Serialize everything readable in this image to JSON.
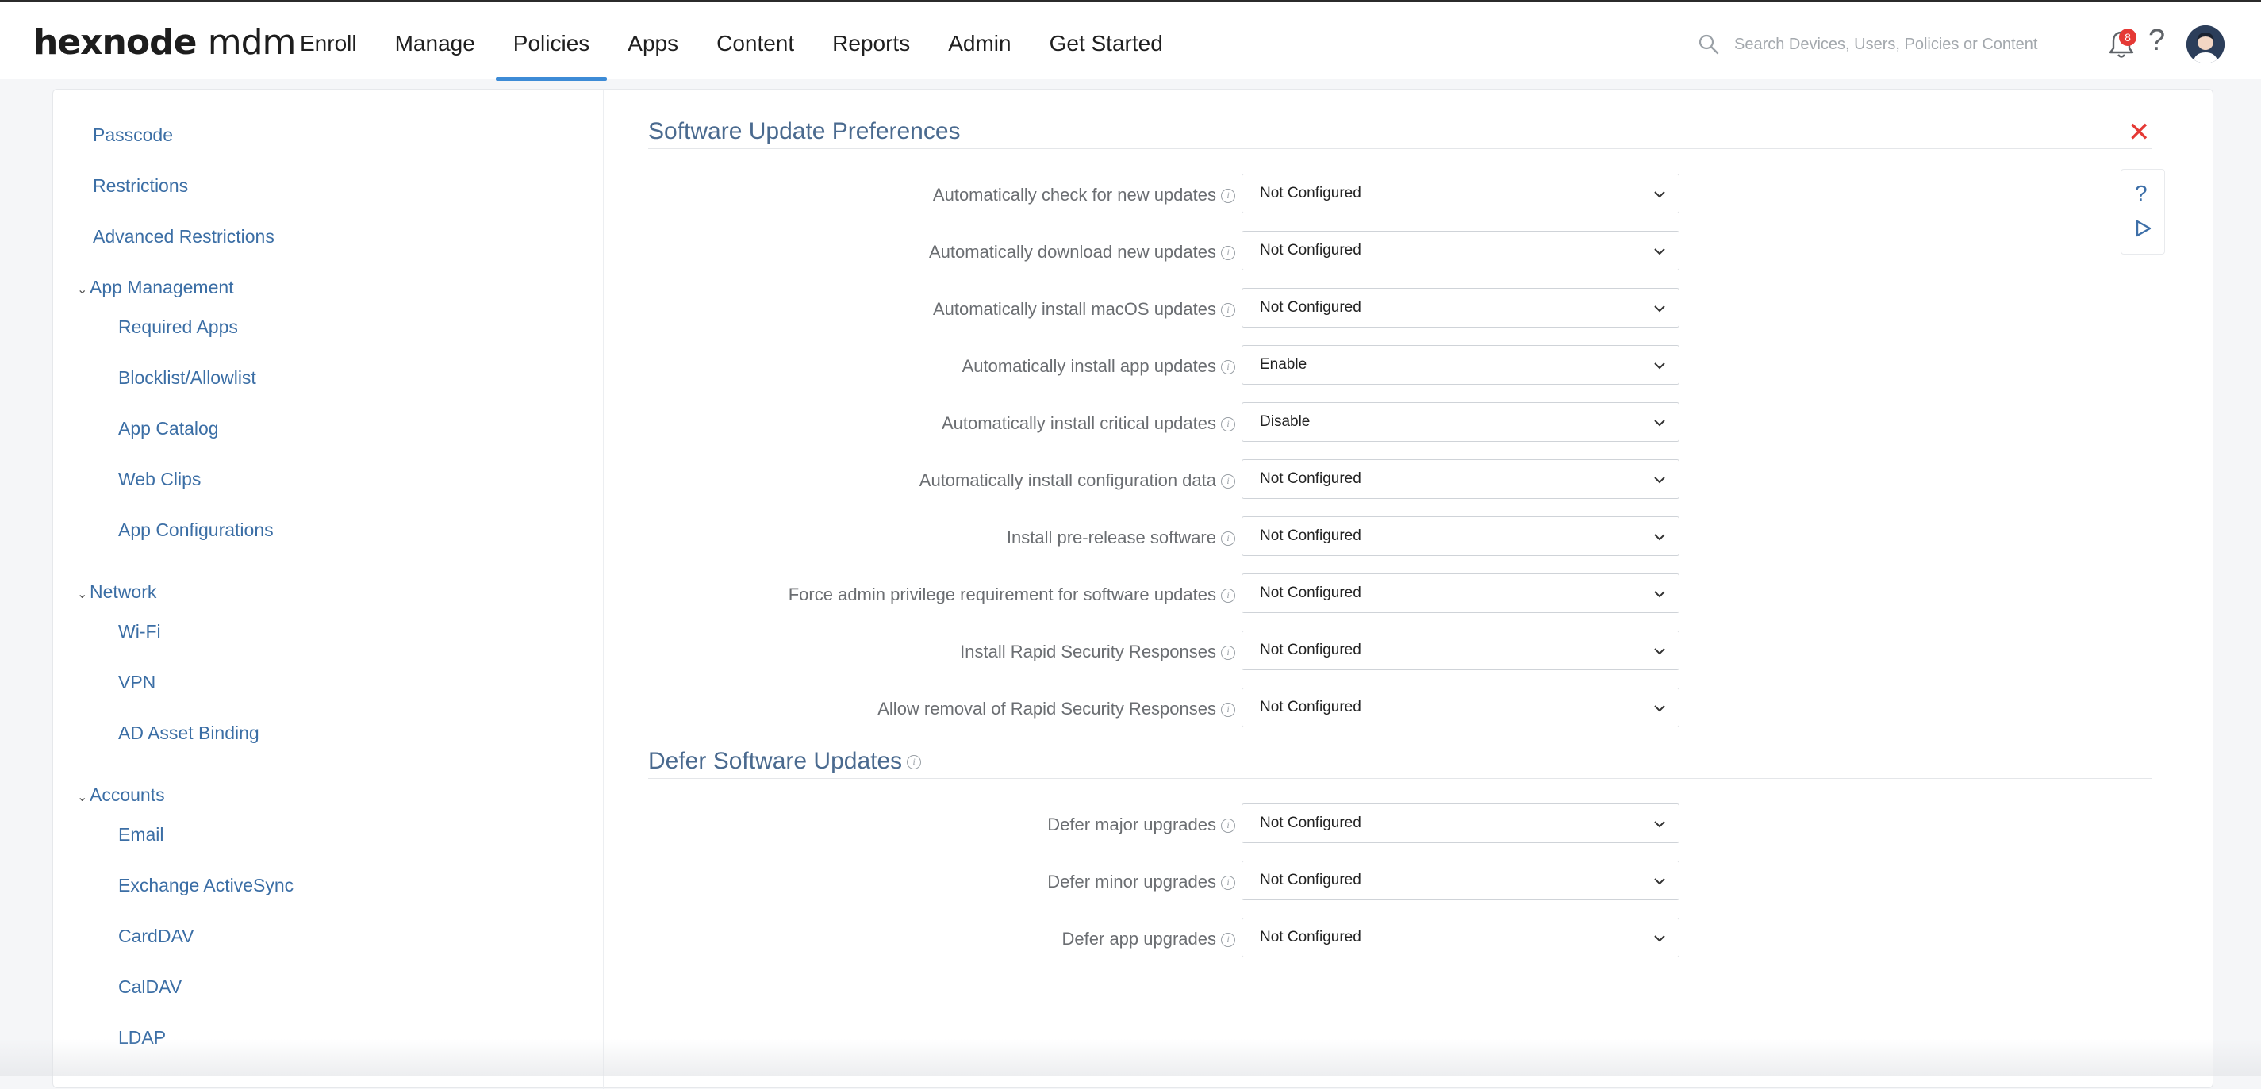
{
  "header": {
    "logo_main": "hexnode",
    "logo_suffix": "mdm",
    "nav": [
      {
        "label": "Enroll"
      },
      {
        "label": "Manage"
      },
      {
        "label": "Policies"
      },
      {
        "label": "Apps"
      },
      {
        "label": "Content"
      },
      {
        "label": "Reports"
      },
      {
        "label": "Admin"
      },
      {
        "label": "Get Started"
      }
    ],
    "active_nav": "Policies",
    "search_placeholder": "Search Devices, Users, Policies or Content",
    "notification_count": "8",
    "help_symbol": "?"
  },
  "sidebar": {
    "items": [
      {
        "label": "Passcode"
      },
      {
        "label": "Restrictions"
      },
      {
        "label": "Advanced Restrictions"
      }
    ],
    "groups": [
      {
        "label": "App Management",
        "items": [
          "Required Apps",
          "Blocklist/Allowlist",
          "App Catalog",
          "Web Clips",
          "App Configurations"
        ]
      },
      {
        "label": "Network",
        "items": [
          "Wi-Fi",
          "VPN",
          "AD Asset Binding"
        ]
      },
      {
        "label": "Accounts",
        "items": [
          "Email",
          "Exchange ActiveSync",
          "CardDAV",
          "CalDAV",
          "LDAP"
        ]
      }
    ]
  },
  "content": {
    "section1_title": "Software Update Preferences",
    "section2_title": "Defer Software Updates",
    "close_symbol": "✕",
    "help_symbol": "?",
    "section1_rows": [
      {
        "label": "Automatically check for new updates",
        "value": "Not Configured"
      },
      {
        "label": "Automatically download new updates",
        "value": "Not Configured"
      },
      {
        "label": "Automatically install macOS updates",
        "value": "Not Configured"
      },
      {
        "label": "Automatically install app updates",
        "value": "Enable"
      },
      {
        "label": "Automatically install critical updates",
        "value": "Disable"
      },
      {
        "label": "Automatically install configuration data",
        "value": "Not Configured"
      },
      {
        "label": "Install pre-release software",
        "value": "Not Configured"
      },
      {
        "label": "Force admin privilege requirement for software updates",
        "value": "Not Configured"
      },
      {
        "label": "Install Rapid Security Responses",
        "value": "Not Configured"
      },
      {
        "label": "Allow removal of Rapid Security Responses",
        "value": "Not Configured"
      }
    ],
    "section2_rows": [
      {
        "label": "Defer major upgrades",
        "value": "Not Configured"
      },
      {
        "label": "Defer minor upgrades",
        "value": "Not Configured"
      },
      {
        "label": "Defer app upgrades",
        "value": "Not Configured"
      }
    ]
  },
  "colors": {
    "accent": "#3d8bd6",
    "link": "#3b6ea5",
    "close": "#e53935",
    "badge": "#e53935"
  },
  "icons": [
    "search-icon",
    "bell-icon",
    "help-icon",
    "avatar",
    "close-icon",
    "play-icon",
    "chevron-down-icon",
    "info-icon"
  ]
}
